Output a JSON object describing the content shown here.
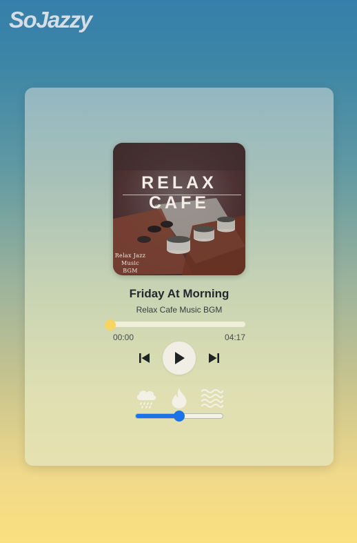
{
  "app": {
    "logo": "SoJazzy"
  },
  "album": {
    "cover_title": "RELAX CAFE",
    "cover_subtitle_lines": [
      "Relax Jazz",
      "Music",
      "BGM"
    ]
  },
  "track": {
    "title": "Friday At Morning",
    "artist": "Relax Cafe Music BGM",
    "current_time": "00:00",
    "duration": "04:17",
    "progress": 0
  },
  "controls": {
    "prev_icon": "skip-previous-icon",
    "play_icon": "play-icon",
    "next_icon": "skip-next-icon"
  },
  "ambient": {
    "sounds": [
      {
        "icon": "rain-cloud-icon"
      },
      {
        "icon": "fire-icon"
      },
      {
        "icon": "waves-icon"
      }
    ],
    "volume": 0.5
  },
  "colors": {
    "accent": "#1b73e8",
    "progress_thumb": "#f7d562"
  }
}
